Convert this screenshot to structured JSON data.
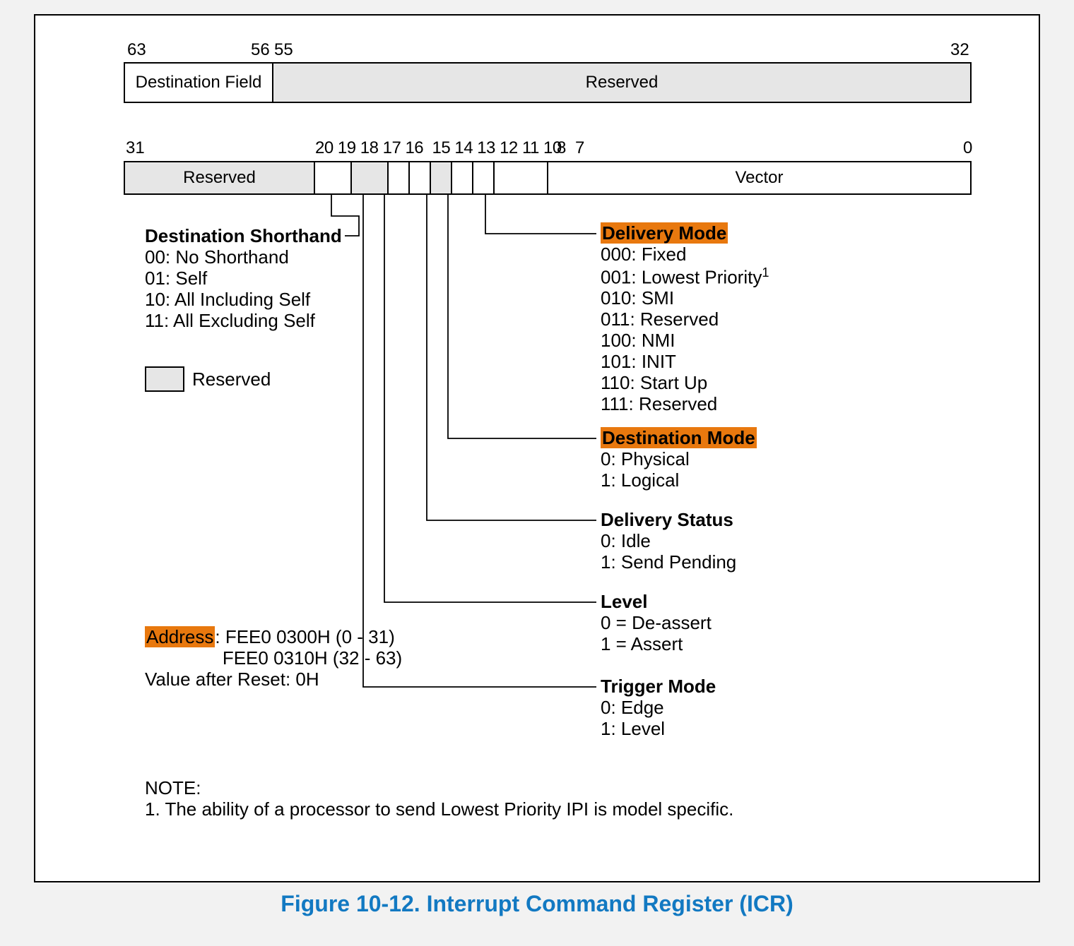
{
  "caption": "Figure 10-12.  Interrupt Command Register (ICR)",
  "upper": {
    "tick63": "63",
    "tick56": "56",
    "tick55": "55",
    "tick32": "32",
    "dest_field": "Destination Field",
    "reserved": "Reserved"
  },
  "lower": {
    "tick31": "31",
    "tick_mid": "20 19 18 17 16  15 14 13 12 11 10",
    "tick8": "8",
    "tick7": "7",
    "tick0": "0",
    "reserved": "Reserved",
    "vector": "Vector"
  },
  "legend": {
    "label": "Reserved"
  },
  "ds": {
    "title": "Destination Shorthand",
    "v00": "00: No Shorthand",
    "v01": "01: Self",
    "v10": "10: All Including Self",
    "v11": "11: All Excluding Self"
  },
  "dmode": {
    "title": "Delivery Mode",
    "v000": "000: Fixed",
    "v001": "001: Lowest Priority",
    "v010": "010: SMI",
    "v011": "011: Reserved",
    "v100": "100: NMI",
    "v101": "101: INIT",
    "v110": "110: Start Up",
    "v111": "111: Reserved"
  },
  "destm": {
    "title": "Destination Mode",
    "v0": "0: Physical",
    "v1": "1: Logical"
  },
  "dstat": {
    "title": "Delivery Status",
    "v0": "0: Idle",
    "v1": "1: Send Pending"
  },
  "level": {
    "title": "Level",
    "v0": "0 = De-assert",
    "v1": "1 = Assert"
  },
  "trig": {
    "title": "Trigger Mode",
    "v0": "0: Edge",
    "v1": "1: Level"
  },
  "addr": {
    "label": "Address",
    "l1": ": FEE0 0300H (0 - 31)",
    "l2": "FEE0 0310H (32 - 63)",
    "reset": "Value after Reset: 0H"
  },
  "note": {
    "head": "NOTE:",
    "body": "1. The ability of a processor to send Lowest Priority IPI is model specific."
  }
}
